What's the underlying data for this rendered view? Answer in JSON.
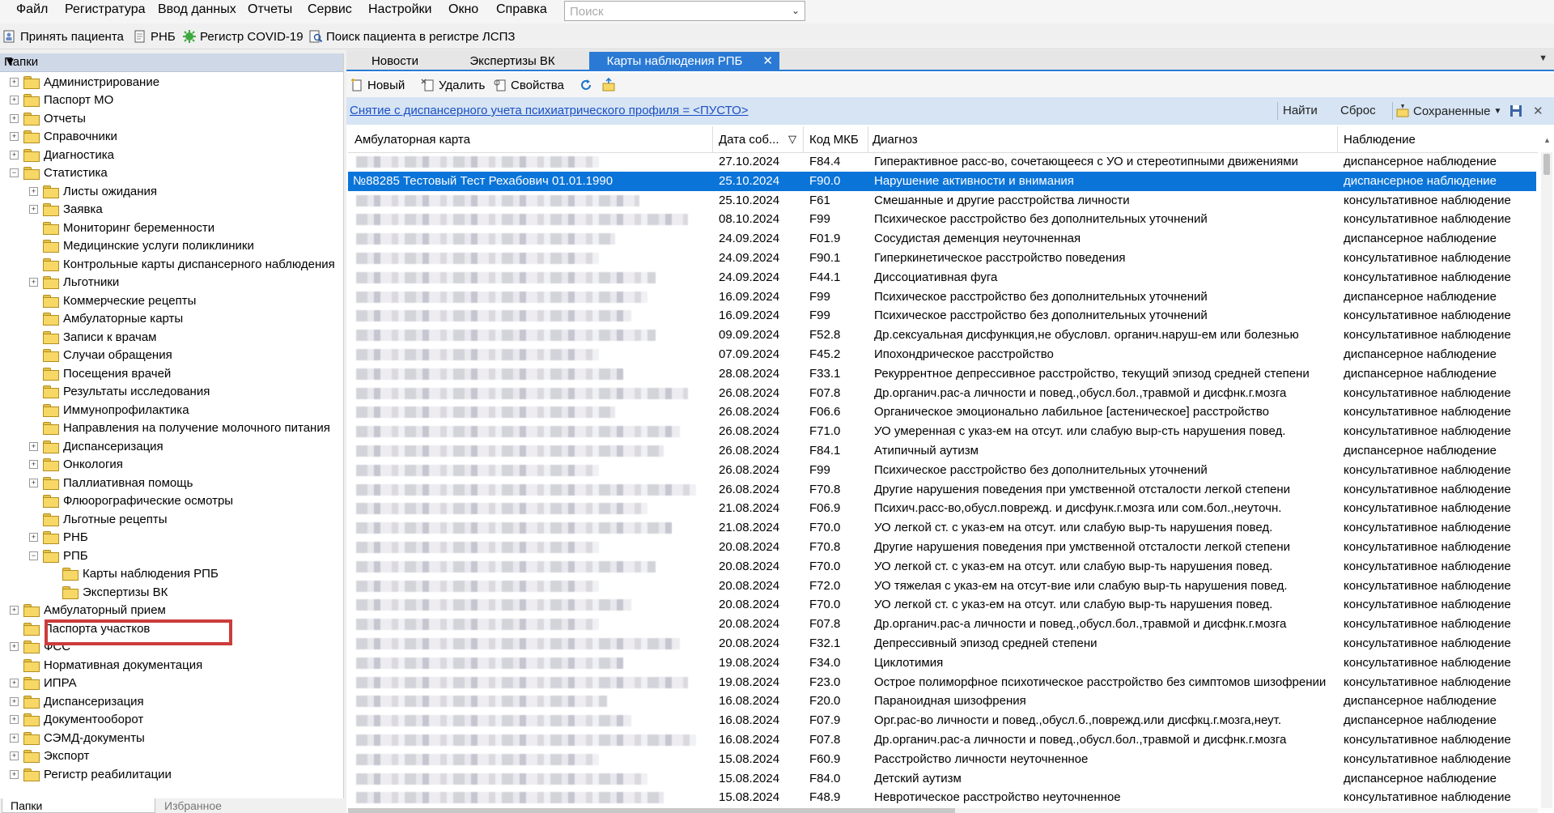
{
  "menu": [
    "Файл",
    "Регистратура",
    "Ввод данных",
    "Отчеты",
    "Сервис",
    "Настройки",
    "Окно",
    "Справка"
  ],
  "search": {
    "placeholder": "Поиск"
  },
  "toolbar": {
    "accept": "Принять пациента",
    "rnb": "РНБ",
    "covid": "Регистр COVID-19",
    "lspz": "Поиск пациента в регистре ЛСПЗ"
  },
  "left_panel": {
    "title": "Папки",
    "tree": [
      {
        "label": "Администрирование",
        "level": 0,
        "exp": "+"
      },
      {
        "label": "Паспорт МО",
        "level": 0,
        "exp": "+"
      },
      {
        "label": "Отчеты",
        "level": 0,
        "exp": "+"
      },
      {
        "label": "Справочники",
        "level": 0,
        "exp": "+"
      },
      {
        "label": "Диагностика",
        "level": 0,
        "exp": "+"
      },
      {
        "label": "Статистика",
        "level": 0,
        "exp": "-"
      },
      {
        "label": "Листы ожидания",
        "level": 1,
        "exp": "+"
      },
      {
        "label": "Заявка",
        "level": 1,
        "exp": "+"
      },
      {
        "label": "Мониторинг беременности",
        "level": 1,
        "exp": ""
      },
      {
        "label": "Медицинские услуги поликлиники",
        "level": 1,
        "exp": ""
      },
      {
        "label": "Контрольные карты диспансерного наблюдения",
        "level": 1,
        "exp": ""
      },
      {
        "label": "Льготники",
        "level": 1,
        "exp": "+"
      },
      {
        "label": "Коммерческие рецепты",
        "level": 1,
        "exp": ""
      },
      {
        "label": "Амбулаторные карты",
        "level": 1,
        "exp": ""
      },
      {
        "label": "Записи к врачам",
        "level": 1,
        "exp": ""
      },
      {
        "label": "Случаи обращения",
        "level": 1,
        "exp": ""
      },
      {
        "label": "Посещения врачей",
        "level": 1,
        "exp": ""
      },
      {
        "label": "Результаты исследования",
        "level": 1,
        "exp": ""
      },
      {
        "label": "Иммунопрофилактика",
        "level": 1,
        "exp": ""
      },
      {
        "label": "Направления на получение молочного питания",
        "level": 1,
        "exp": ""
      },
      {
        "label": "Диспансеризация",
        "level": 1,
        "exp": "+"
      },
      {
        "label": "Онкология",
        "level": 1,
        "exp": "+"
      },
      {
        "label": "Паллиативная помощь",
        "level": 1,
        "exp": "+"
      },
      {
        "label": "Флюорографические осмотры",
        "level": 1,
        "exp": ""
      },
      {
        "label": "Льготные рецепты",
        "level": 1,
        "exp": ""
      },
      {
        "label": "РНБ",
        "level": 1,
        "exp": "+"
      },
      {
        "label": "РПБ",
        "level": 1,
        "exp": "-"
      },
      {
        "label": "Карты наблюдения РПБ",
        "level": 2,
        "exp": ""
      },
      {
        "label": "Экспертизы ВК",
        "level": 2,
        "exp": ""
      },
      {
        "label": "Амбулаторный прием",
        "level": 0,
        "exp": "+"
      },
      {
        "label": "Паспорта участков",
        "level": 0,
        "exp": ""
      },
      {
        "label": "ФСС",
        "level": 0,
        "exp": "+"
      },
      {
        "label": "Нормативная документация",
        "level": 0,
        "exp": ""
      },
      {
        "label": "ИПРА",
        "level": 0,
        "exp": "+"
      },
      {
        "label": "Диспансеризация",
        "level": 0,
        "exp": "+"
      },
      {
        "label": "Документооборот",
        "level": 0,
        "exp": "+"
      },
      {
        "label": "СЭМД-документы",
        "level": 0,
        "exp": "+"
      },
      {
        "label": "Экспорт",
        "level": 0,
        "exp": "+"
      },
      {
        "label": "Регистр реабилитации",
        "level": 0,
        "exp": "+"
      }
    ],
    "bottom_tabs": [
      "Папки",
      "Избранное"
    ]
  },
  "tabs": [
    "Новости",
    "Экспертизы ВК",
    "Карты наблюдения РПБ"
  ],
  "actions": {
    "new": "Новый",
    "delete": "Удалить",
    "props": "Свойства"
  },
  "filter": {
    "text": "Снятие с диспансерного учета психиатрического профиля = <ПУСТО>",
    "find": "Найти",
    "reset": "Сброс",
    "saved": "Сохраненные"
  },
  "grid": {
    "columns": [
      "Амбулаторная карта",
      "Дата соб...",
      "Код МКБ",
      "Диагноз",
      "Наблюдение"
    ],
    "rows": [
      {
        "card": "",
        "date": "27.10.2024",
        "code": "F84.4",
        "diag": "Гиперактивное расс-во, сочетающееся с УО и стереотипными движениями",
        "obs": "диспансерное наблюдение"
      },
      {
        "card": "№88285 Тестовый Тест Рехабович 01.01.1990",
        "date": "25.10.2024",
        "code": "F90.0",
        "diag": "Нарушение активности и внимания",
        "obs": "диспансерное наблюдение"
      },
      {
        "card": "",
        "date": "25.10.2024",
        "code": "F61",
        "diag": "Смешанные и другие расстройства личности",
        "obs": "консультативное наблюдение"
      },
      {
        "card": "",
        "date": "08.10.2024",
        "code": "F99",
        "diag": "Психическое расстройство без дополнительных уточнений",
        "obs": "консультативное наблюдение"
      },
      {
        "card": "",
        "date": "24.09.2024",
        "code": "F01.9",
        "diag": "Сосудистая деменция неуточненная",
        "obs": "диспансерное наблюдение"
      },
      {
        "card": "",
        "date": "24.09.2024",
        "code": "F90.1",
        "diag": "Гиперкинетическое расстройство поведения",
        "obs": "консультативное наблюдение"
      },
      {
        "card": "",
        "date": "24.09.2024",
        "code": "F44.1",
        "diag": "Диссоциативная фуга",
        "obs": "консультативное наблюдение"
      },
      {
        "card": "",
        "date": "16.09.2024",
        "code": "F99",
        "diag": "Психическое расстройство без дополнительных уточнений",
        "obs": "диспансерное наблюдение"
      },
      {
        "card": "",
        "date": "16.09.2024",
        "code": "F99",
        "diag": "Психическое расстройство без дополнительных уточнений",
        "obs": "консультативное наблюдение"
      },
      {
        "card": "",
        "date": "09.09.2024",
        "code": "F52.8",
        "diag": "Др.сексуальная дисфункция,не обусловл. органич.наруш-ем или болезнью",
        "obs": "консультативное наблюдение"
      },
      {
        "card": "",
        "date": "07.09.2024",
        "code": "F45.2",
        "diag": "Ипохондрическое расстройство",
        "obs": "диспансерное наблюдение"
      },
      {
        "card": "",
        "date": "28.08.2024",
        "code": "F33.1",
        "diag": "Рекуррентное депрессивное расстройство, текущий эпизод средней степени",
        "obs": "диспансерное наблюдение"
      },
      {
        "card": "",
        "date": "26.08.2024",
        "code": "F07.8",
        "diag": "Др.органич.рас-а личности и повед.,обусл.бол.,травмой и дисфнк.г.мозга",
        "obs": "консультативное наблюдение"
      },
      {
        "card": "",
        "date": "26.08.2024",
        "code": "F06.6",
        "diag": "Органическое эмоционально лабильное [астеническое] расстройство",
        "obs": "консультативное наблюдение"
      },
      {
        "card": "",
        "date": "26.08.2024",
        "code": "F71.0",
        "diag": "УО умеренная с указ-ем на отсут. или слабую выр-сть нарушения повед.",
        "obs": "консультативное наблюдение"
      },
      {
        "card": "",
        "date": "26.08.2024",
        "code": "F84.1",
        "diag": "Атипичный аутизм",
        "obs": "диспансерное наблюдение"
      },
      {
        "card": "",
        "date": "26.08.2024",
        "code": "F99",
        "diag": "Психическое расстройство без дополнительных уточнений",
        "obs": "консультативное наблюдение"
      },
      {
        "card": "",
        "date": "26.08.2024",
        "code": "F70.8",
        "diag": "Другие нарушения поведения при умственной отсталости легкой степени",
        "obs": "консультативное наблюдение"
      },
      {
        "card": "",
        "date": "21.08.2024",
        "code": "F06.9",
        "diag": "Психич.расс-во,обусл.поврежд. и дисфунк.г.мозга или сом.бол.,неуточн.",
        "obs": "консультативное наблюдение"
      },
      {
        "card": "",
        "date": "21.08.2024",
        "code": "F70.0",
        "diag": "УО легкой ст. с указ-ем на отсут. или слабую выр-ть нарушения повед.",
        "obs": "консультативное наблюдение"
      },
      {
        "card": "",
        "date": "20.08.2024",
        "code": "F70.8",
        "diag": "Другие нарушения поведения при умственной отсталости легкой степени",
        "obs": "консультативное наблюдение"
      },
      {
        "card": "",
        "date": "20.08.2024",
        "code": "F70.0",
        "diag": "УО легкой ст. с указ-ем на отсут. или слабую выр-ть нарушения повед.",
        "obs": "консультативное наблюдение"
      },
      {
        "card": "",
        "date": "20.08.2024",
        "code": "F72.0",
        "diag": "УО тяжелая с указ-ем на отсут-вие или слабую выр-ть нарушения повед.",
        "obs": "консультативное наблюдение"
      },
      {
        "card": "",
        "date": "20.08.2024",
        "code": "F70.0",
        "diag": "УО легкой ст. с указ-ем на отсут. или слабую выр-ть нарушения повед.",
        "obs": "консультативное наблюдение"
      },
      {
        "card": "",
        "date": "20.08.2024",
        "code": "F07.8",
        "diag": "Др.органич.рас-а личности и повед.,обусл.бол.,травмой и дисфнк.г.мозга",
        "obs": "консультативное наблюдение"
      },
      {
        "card": "",
        "date": "20.08.2024",
        "code": "F32.1",
        "diag": "Депрессивный эпизод средней степени",
        "obs": "консультативное наблюдение"
      },
      {
        "card": "",
        "date": "19.08.2024",
        "code": "F34.0",
        "diag": "Циклотимия",
        "obs": "консультативное наблюдение"
      },
      {
        "card": "",
        "date": "19.08.2024",
        "code": "F23.0",
        "diag": "Острое полиморфное психотическое расстройство без симптомов шизофрении",
        "obs": "консультативное наблюдение"
      },
      {
        "card": "",
        "date": "16.08.2024",
        "code": "F20.0",
        "diag": "Параноидная шизофрения",
        "obs": "диспансерное наблюдение"
      },
      {
        "card": "",
        "date": "16.08.2024",
        "code": "F07.9",
        "diag": "Орг.рас-во личности и повед.,обусл.б.,поврежд.или дисфкц.г.мозга,неут.",
        "obs": "диспансерное наблюдение"
      },
      {
        "card": "",
        "date": "16.08.2024",
        "code": "F07.8",
        "diag": "Др.органич.рас-а личности и повед.,обусл.бол.,травмой и дисфнк.г.мозга",
        "obs": "консультативное наблюдение"
      },
      {
        "card": "",
        "date": "15.08.2024",
        "code": "F60.9",
        "diag": "Расстройство личности неуточненное",
        "obs": "консультативное наблюдение"
      },
      {
        "card": "",
        "date": "15.08.2024",
        "code": "F84.0",
        "diag": "Детский аутизм",
        "obs": "диспансерное наблюдение"
      },
      {
        "card": "",
        "date": "15.08.2024",
        "code": "F48.9",
        "diag": "Невротическое расстройство неуточненное",
        "obs": "консультативное наблюдение"
      }
    ]
  }
}
